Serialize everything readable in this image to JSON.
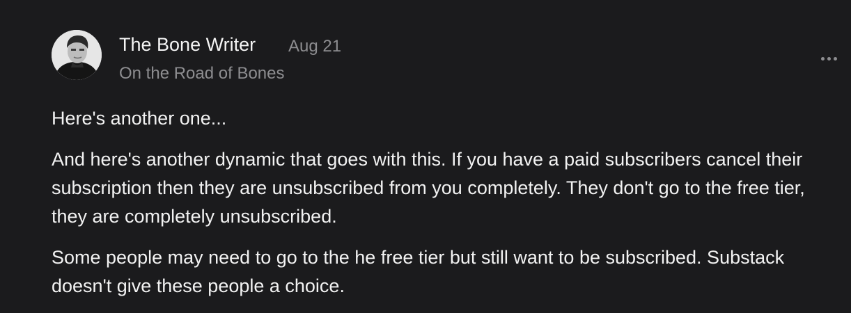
{
  "comment": {
    "author": "The Bone Writer",
    "date": "Aug 21",
    "publication": "On the Road of Bones",
    "more_icon": "ellipsis-horizontal-icon",
    "avatar_icon": "author-portrait",
    "paragraphs": [
      "Here's another one...",
      "And here's another dynamic that goes with this. If you have a paid subscribers cancel their subscription then they are unsubscribed from you completely. They don't go to the free tier, they are completely unsubscribed.",
      "Some people may need to go to the he free tier but still want to be subscribed. Substack doesn't give these people a choice."
    ]
  },
  "colors": {
    "background": "#1b1b1d",
    "text": "#f2f2f2",
    "muted": "#8d8d90"
  }
}
